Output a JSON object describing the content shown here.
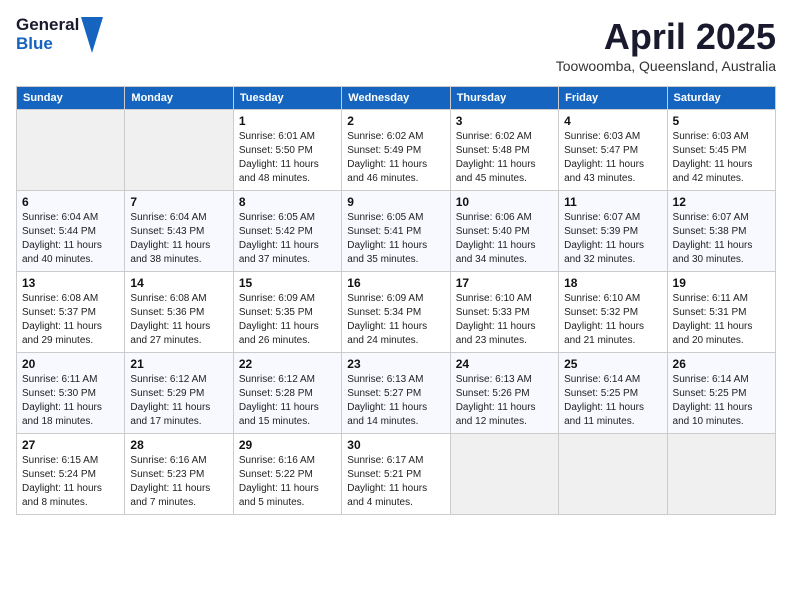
{
  "logo": {
    "general": "General",
    "blue": "Blue"
  },
  "title": "April 2025",
  "location": "Toowoomba, Queensland, Australia",
  "headers": [
    "Sunday",
    "Monday",
    "Tuesday",
    "Wednesday",
    "Thursday",
    "Friday",
    "Saturday"
  ],
  "weeks": [
    [
      {
        "day": "",
        "info": ""
      },
      {
        "day": "",
        "info": ""
      },
      {
        "day": "1",
        "info": "Sunrise: 6:01 AM\nSunset: 5:50 PM\nDaylight: 11 hours and 48 minutes."
      },
      {
        "day": "2",
        "info": "Sunrise: 6:02 AM\nSunset: 5:49 PM\nDaylight: 11 hours and 46 minutes."
      },
      {
        "day": "3",
        "info": "Sunrise: 6:02 AM\nSunset: 5:48 PM\nDaylight: 11 hours and 45 minutes."
      },
      {
        "day": "4",
        "info": "Sunrise: 6:03 AM\nSunset: 5:47 PM\nDaylight: 11 hours and 43 minutes."
      },
      {
        "day": "5",
        "info": "Sunrise: 6:03 AM\nSunset: 5:45 PM\nDaylight: 11 hours and 42 minutes."
      }
    ],
    [
      {
        "day": "6",
        "info": "Sunrise: 6:04 AM\nSunset: 5:44 PM\nDaylight: 11 hours and 40 minutes."
      },
      {
        "day": "7",
        "info": "Sunrise: 6:04 AM\nSunset: 5:43 PM\nDaylight: 11 hours and 38 minutes."
      },
      {
        "day": "8",
        "info": "Sunrise: 6:05 AM\nSunset: 5:42 PM\nDaylight: 11 hours and 37 minutes."
      },
      {
        "day": "9",
        "info": "Sunrise: 6:05 AM\nSunset: 5:41 PM\nDaylight: 11 hours and 35 minutes."
      },
      {
        "day": "10",
        "info": "Sunrise: 6:06 AM\nSunset: 5:40 PM\nDaylight: 11 hours and 34 minutes."
      },
      {
        "day": "11",
        "info": "Sunrise: 6:07 AM\nSunset: 5:39 PM\nDaylight: 11 hours and 32 minutes."
      },
      {
        "day": "12",
        "info": "Sunrise: 6:07 AM\nSunset: 5:38 PM\nDaylight: 11 hours and 30 minutes."
      }
    ],
    [
      {
        "day": "13",
        "info": "Sunrise: 6:08 AM\nSunset: 5:37 PM\nDaylight: 11 hours and 29 minutes."
      },
      {
        "day": "14",
        "info": "Sunrise: 6:08 AM\nSunset: 5:36 PM\nDaylight: 11 hours and 27 minutes."
      },
      {
        "day": "15",
        "info": "Sunrise: 6:09 AM\nSunset: 5:35 PM\nDaylight: 11 hours and 26 minutes."
      },
      {
        "day": "16",
        "info": "Sunrise: 6:09 AM\nSunset: 5:34 PM\nDaylight: 11 hours and 24 minutes."
      },
      {
        "day": "17",
        "info": "Sunrise: 6:10 AM\nSunset: 5:33 PM\nDaylight: 11 hours and 23 minutes."
      },
      {
        "day": "18",
        "info": "Sunrise: 6:10 AM\nSunset: 5:32 PM\nDaylight: 11 hours and 21 minutes."
      },
      {
        "day": "19",
        "info": "Sunrise: 6:11 AM\nSunset: 5:31 PM\nDaylight: 11 hours and 20 minutes."
      }
    ],
    [
      {
        "day": "20",
        "info": "Sunrise: 6:11 AM\nSunset: 5:30 PM\nDaylight: 11 hours and 18 minutes."
      },
      {
        "day": "21",
        "info": "Sunrise: 6:12 AM\nSunset: 5:29 PM\nDaylight: 11 hours and 17 minutes."
      },
      {
        "day": "22",
        "info": "Sunrise: 6:12 AM\nSunset: 5:28 PM\nDaylight: 11 hours and 15 minutes."
      },
      {
        "day": "23",
        "info": "Sunrise: 6:13 AM\nSunset: 5:27 PM\nDaylight: 11 hours and 14 minutes."
      },
      {
        "day": "24",
        "info": "Sunrise: 6:13 AM\nSunset: 5:26 PM\nDaylight: 11 hours and 12 minutes."
      },
      {
        "day": "25",
        "info": "Sunrise: 6:14 AM\nSunset: 5:25 PM\nDaylight: 11 hours and 11 minutes."
      },
      {
        "day": "26",
        "info": "Sunrise: 6:14 AM\nSunset: 5:25 PM\nDaylight: 11 hours and 10 minutes."
      }
    ],
    [
      {
        "day": "27",
        "info": "Sunrise: 6:15 AM\nSunset: 5:24 PM\nDaylight: 11 hours and 8 minutes."
      },
      {
        "day": "28",
        "info": "Sunrise: 6:16 AM\nSunset: 5:23 PM\nDaylight: 11 hours and 7 minutes."
      },
      {
        "day": "29",
        "info": "Sunrise: 6:16 AM\nSunset: 5:22 PM\nDaylight: 11 hours and 5 minutes."
      },
      {
        "day": "30",
        "info": "Sunrise: 6:17 AM\nSunset: 5:21 PM\nDaylight: 11 hours and 4 minutes."
      },
      {
        "day": "",
        "info": ""
      },
      {
        "day": "",
        "info": ""
      },
      {
        "day": "",
        "info": ""
      }
    ]
  ]
}
